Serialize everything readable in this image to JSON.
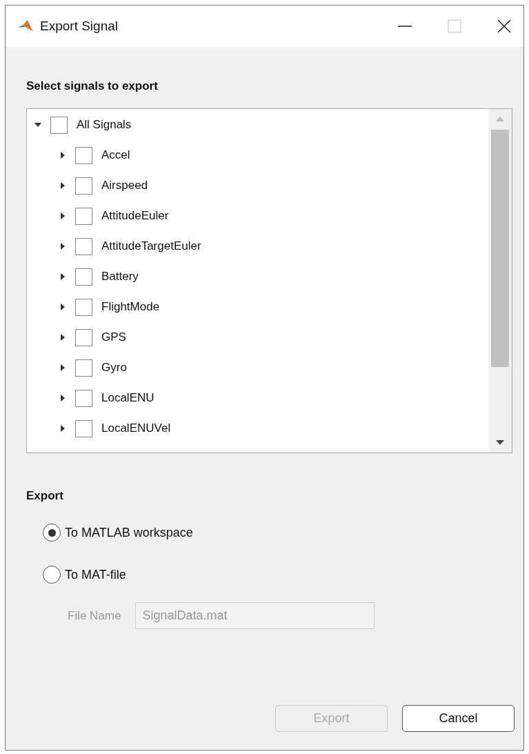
{
  "window": {
    "title": "Export Signal"
  },
  "signals": {
    "heading": "Select signals to export",
    "tree": [
      {
        "label": "All Signals",
        "checked": false,
        "expanded": true,
        "children": [
          {
            "label": "Accel",
            "checked": false,
            "expanded": false
          },
          {
            "label": "Airspeed",
            "checked": false,
            "expanded": false
          },
          {
            "label": "AttitudeEuler",
            "checked": false,
            "expanded": false
          },
          {
            "label": "AttitudeTargetEuler",
            "checked": false,
            "expanded": false
          },
          {
            "label": "Battery",
            "checked": false,
            "expanded": false
          },
          {
            "label": "FlightMode",
            "checked": false,
            "expanded": false
          },
          {
            "label": "GPS",
            "checked": false,
            "expanded": false
          },
          {
            "label": "Gyro",
            "checked": false,
            "expanded": false
          },
          {
            "label": "LocalENU",
            "checked": false,
            "expanded": false
          },
          {
            "label": "LocalENUVel",
            "checked": false,
            "expanded": false
          }
        ]
      }
    ]
  },
  "export": {
    "heading": "Export",
    "options": [
      {
        "label": "To MATLAB workspace",
        "selected": true
      },
      {
        "label": "To MAT-file",
        "selected": false
      }
    ],
    "file_name": {
      "label": "File Name",
      "value": "SignalData.mat",
      "disabled": true
    }
  },
  "buttons": [
    {
      "label": "Export",
      "disabled": true
    },
    {
      "label": "Cancel",
      "disabled": false
    }
  ]
}
